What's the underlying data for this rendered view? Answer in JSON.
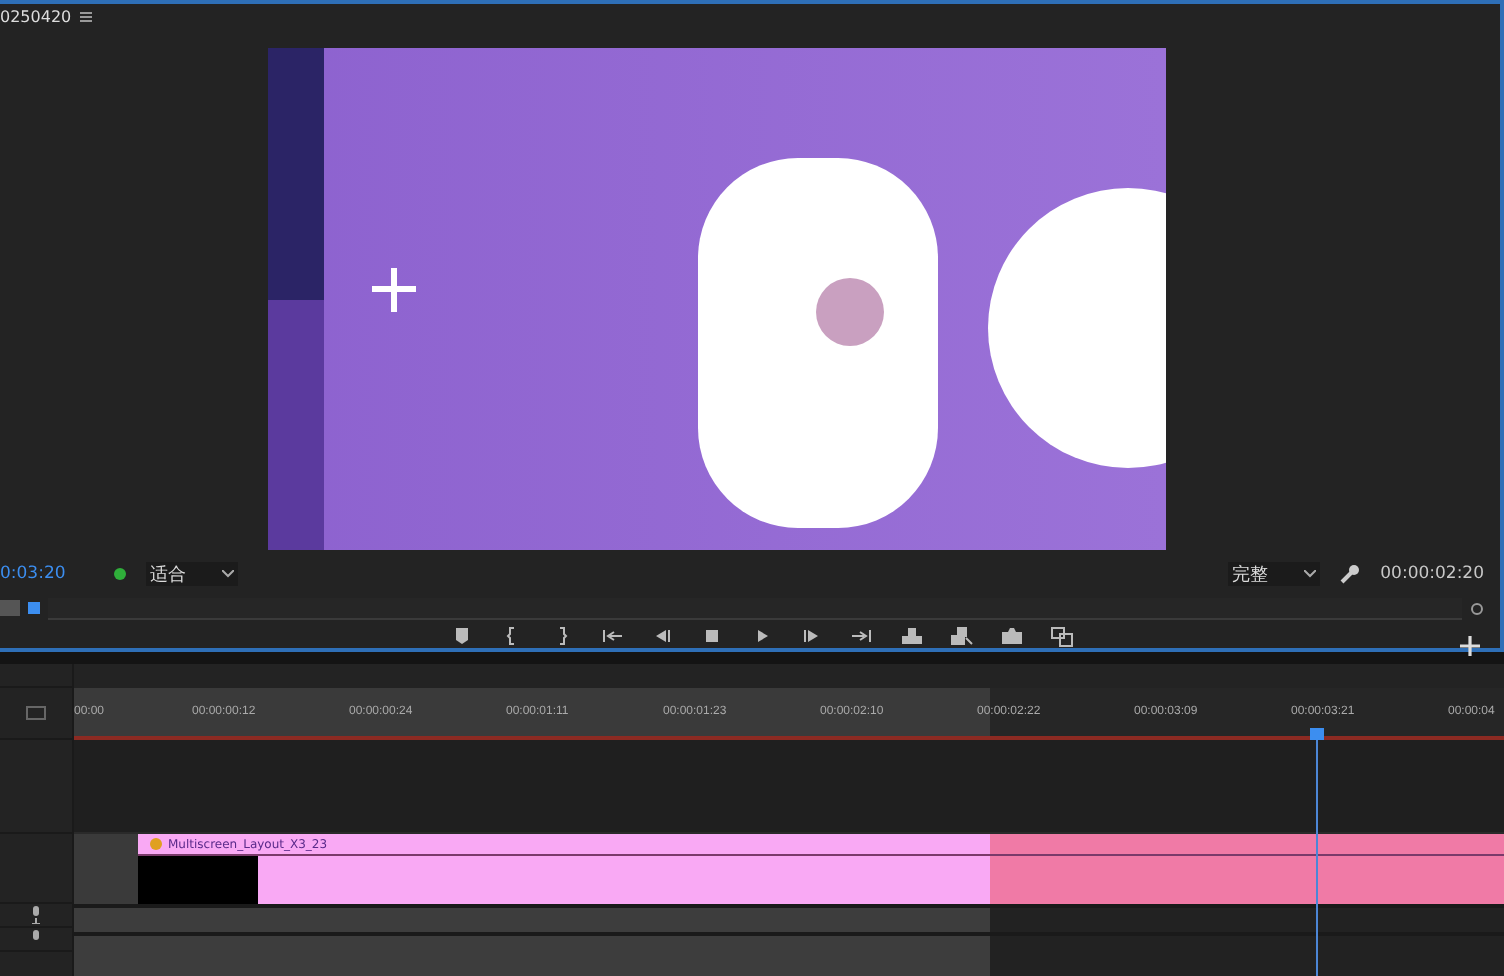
{
  "monitor": {
    "title": "0250420",
    "timecode": "0:03:20",
    "zoom": "适合",
    "resolution": "完整",
    "duration": "00:00:02:20"
  },
  "timeline": {
    "ruler": [
      "00:00",
      "00:00:00:12",
      "00:00:00:24",
      "00:00:01:11",
      "00:00:01:23",
      "00:00:02:10",
      "00:00:02:22",
      "00:00:03:09",
      "00:00:03:21",
      "00:00:04"
    ],
    "clips": [
      {
        "name": "Multiscreen_Layout_X3_23"
      }
    ]
  }
}
